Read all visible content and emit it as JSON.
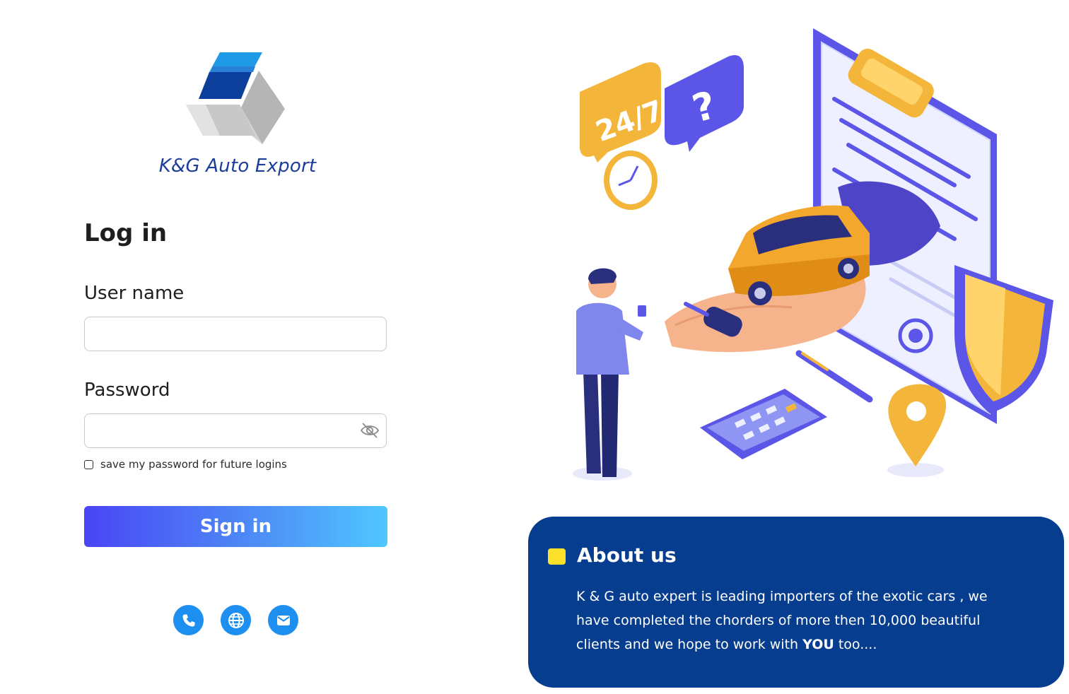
{
  "brand": {
    "name": "K&G Auto Export",
    "logo_icon": "cube-logo-icon"
  },
  "login": {
    "title": "Log in",
    "username_label": "User name",
    "username_value": "",
    "username_placeholder": "",
    "password_label": "Password",
    "password_value": "",
    "password_placeholder": "",
    "password_toggle_icon": "eye-slash-icon",
    "save_password_label": "save my password for future logins",
    "save_password_checked": false,
    "signin_label": "Sign in"
  },
  "contact": {
    "icons": [
      "phone-icon",
      "globe-icon",
      "mail-icon"
    ]
  },
  "about": {
    "title": "About us",
    "text_before": "K & G auto expert is leading importers of the exotic cars , we have completed the chorders of more then 10,000 beautiful clients and we hope to work with ",
    "text_bold": "YOU",
    "text_after": " too...."
  },
  "illustration": {
    "badge_247": "24/7",
    "badge_question": "?"
  },
  "colors": {
    "brand_blue": "#1b3e9a",
    "about_bg": "#063d8e",
    "accent_yellow": "#fde02a",
    "button_start": "#4a45f5",
    "button_end": "#4fc7ff",
    "icon_blue": "#1c8ff0"
  }
}
